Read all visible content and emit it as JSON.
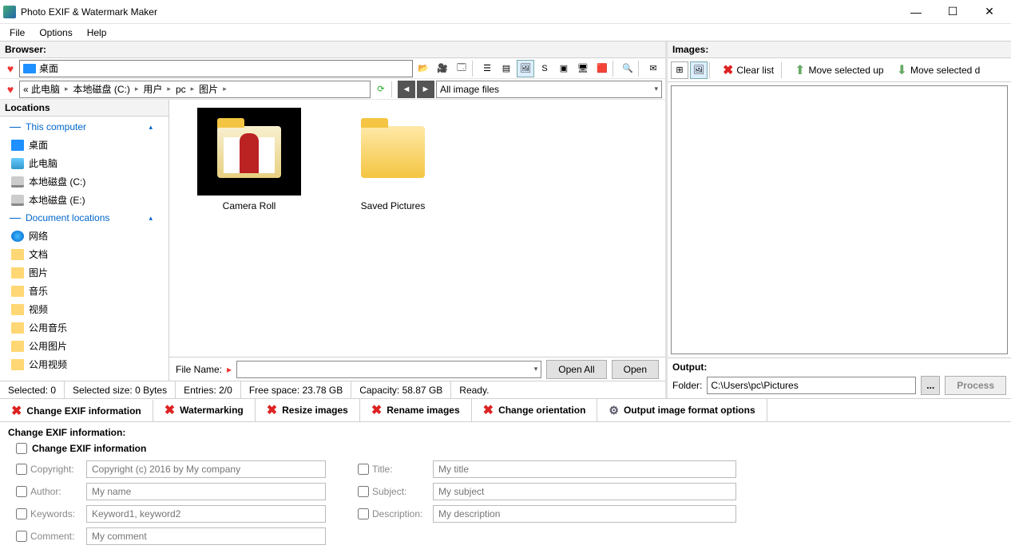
{
  "title": "Photo EXIF & Watermark Maker",
  "menu": {
    "file": "File",
    "options": "Options",
    "help": "Help"
  },
  "browser": {
    "header": "Browser:",
    "address": "桌面",
    "breadcrumb": [
      "« 此电脑",
      "本地磁盘 (C:)",
      "用户",
      "pc",
      "图片"
    ],
    "filter": "All image files",
    "locations_header": "Locations",
    "groups": {
      "computer": "This computer",
      "docs": "Document locations"
    },
    "loc_items_computer": [
      "桌面",
      "此电脑",
      "本地磁盘 (C:)",
      "本地磁盘 (E:)"
    ],
    "loc_items_docs": [
      "网络",
      "文档",
      "图片",
      "音乐",
      "视频",
      "公用音乐",
      "公用图片",
      "公用视频"
    ],
    "thumbs": {
      "camera_roll": "Camera Roll",
      "saved_pictures": "Saved Pictures"
    },
    "file_name_label": "File Name:",
    "open_all": "Open All",
    "open": "Open"
  },
  "status": {
    "selected": "Selected: 0",
    "size": "Selected size: 0 Bytes",
    "entries": "Entries: 2/0",
    "free": "Free space: 23.78 GB",
    "capacity": "Capacity: 58.87 GB",
    "ready": "Ready."
  },
  "images": {
    "header": "Images:",
    "clear": "Clear list",
    "up": "Move selected up",
    "down": "Move selected d",
    "output_header": "Output:",
    "folder_label": "Folder:",
    "folder_value": "C:\\Users\\pc\\Pictures",
    "process": "Process"
  },
  "tabs": {
    "exif": "Change EXIF information",
    "watermark": "Watermarking",
    "resize": "Resize images",
    "rename": "Rename images",
    "orient": "Change orientation",
    "format": "Output image format options"
  },
  "exif_panel": {
    "legend": "Change EXIF information:",
    "checkbox": "Change EXIF information",
    "labels": {
      "copyright": "Copyright:",
      "author": "Author:",
      "keywords": "Keywords:",
      "comment": "Comment:",
      "title": "Title:",
      "subject": "Subject:",
      "description": "Description:"
    },
    "placeholders": {
      "copyright": "Copyright (c) 2016 by My company",
      "author": "My name",
      "keywords": "Keyword1, keyword2",
      "comment": "My comment",
      "title": "My title",
      "subject": "My subject",
      "description": "My description"
    }
  }
}
